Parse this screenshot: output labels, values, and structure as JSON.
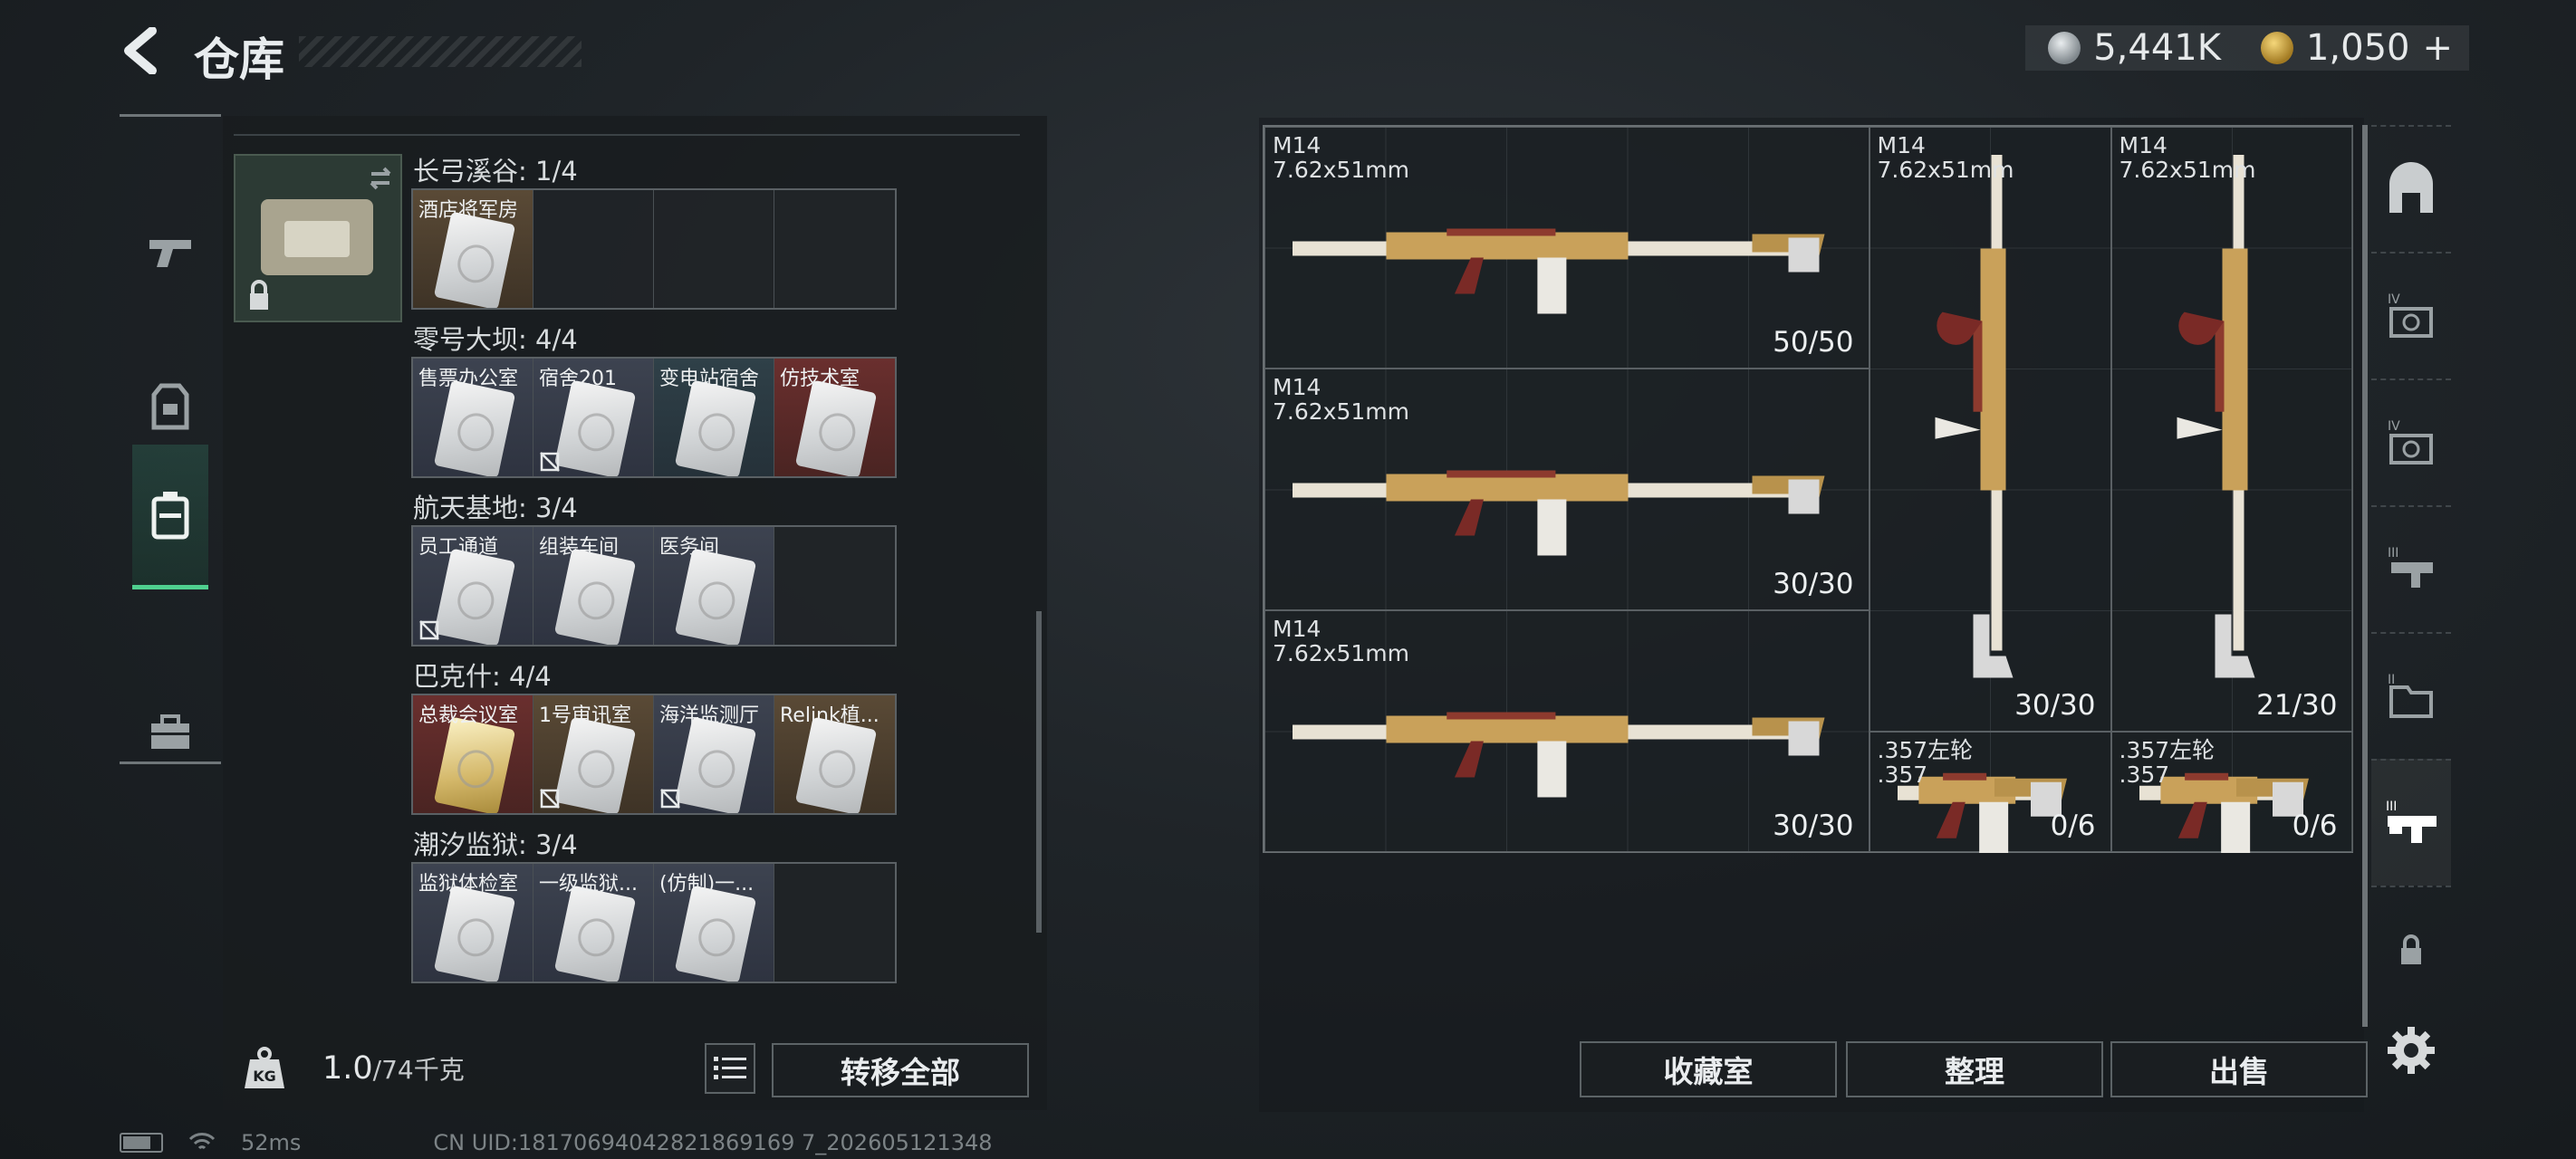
{
  "header": {
    "title": "仓库",
    "currency_silver": "5,441K",
    "currency_gold": "1,050",
    "gold_plus": "+"
  },
  "left_panel": {
    "regions": [
      {
        "title": "长弓溪谷: 1/4",
        "slots": [
          {
            "label": "酒店将军房",
            "style": "brown",
            "card": true,
            "locked": false
          },
          {
            "label": "",
            "style": "empty"
          },
          {
            "label": "",
            "style": "empty"
          },
          {
            "label": "",
            "style": "empty"
          }
        ]
      },
      {
        "title": "零号大坝: 4/4",
        "slots": [
          {
            "label": "售票办公室",
            "style": "gray",
            "card": true
          },
          {
            "label": "宿舍201",
            "style": "gray",
            "card": true,
            "marked": true
          },
          {
            "label": "变电站宿舍",
            "style": "teal",
            "card": true
          },
          {
            "label": "仿技术室",
            "style": "red",
            "card": true
          }
        ]
      },
      {
        "title": "航天基地: 3/4",
        "slots": [
          {
            "label": "员工通道",
            "style": "gray",
            "card": true,
            "marked": true
          },
          {
            "label": "组装车间",
            "style": "gray",
            "card": true
          },
          {
            "label": "医务间",
            "style": "gray",
            "card": true
          },
          {
            "label": "",
            "style": "empty"
          }
        ]
      },
      {
        "title": "巴克什: 4/4",
        "slots": [
          {
            "label": "总裁会议室",
            "style": "red",
            "card": true,
            "gold": true
          },
          {
            "label": "1号审讯室",
            "style": "brown",
            "card": true,
            "marked": true
          },
          {
            "label": "海洋监测厅",
            "style": "gray",
            "card": true,
            "marked": true
          },
          {
            "label": "Relink植...",
            "style": "brown",
            "card": true
          }
        ]
      },
      {
        "title": "潮汐监狱: 3/4",
        "slots": [
          {
            "label": "监狱体检室",
            "style": "gray",
            "card": true
          },
          {
            "label": "一级监狱...",
            "style": "gray",
            "card": true
          },
          {
            "label": "(仿制)一...",
            "style": "gray",
            "card": true
          },
          {
            "label": "",
            "style": "empty"
          }
        ]
      }
    ],
    "weight": "1.0",
    "weight_capacity": "/74千克",
    "transfer_all": "转移全部"
  },
  "weapons": [
    {
      "name": "M14",
      "caliber": "7.62x51mm",
      "ammo": "50/50"
    },
    {
      "name": "M14",
      "caliber": "7.62x51mm",
      "ammo": "30/30"
    },
    {
      "name": "M14",
      "caliber": "7.62x51mm",
      "ammo": "30/30"
    },
    {
      "name": "M14",
      "caliber": "7.62x51mm",
      "ammo": "30/30"
    },
    {
      "name": "M14",
      "caliber": "7.62x51mm",
      "ammo": "21/30"
    },
    {
      "name": ".357左轮",
      "caliber": ".357",
      "ammo": "0/6"
    },
    {
      "name": ".357左轮",
      "caliber": ".357",
      "ammo": "0/6"
    }
  ],
  "actions": {
    "collection": "收藏室",
    "organize": "整理",
    "sell": "出售"
  },
  "status_bar": {
    "ping": "52ms",
    "uid": "CN UID:18170694042821869169 7_202605121348"
  },
  "colors": {
    "accent_green": "#4fd08f",
    "panel_bg": "#181c1f"
  }
}
